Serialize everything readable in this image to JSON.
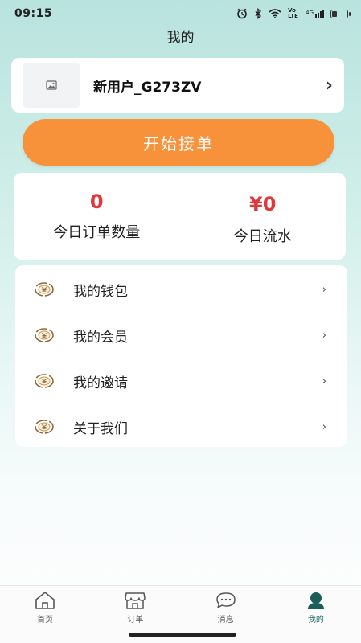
{
  "status_bar": {
    "time": "09:15",
    "signal_text": "4G",
    "volte_text": "Vo LTE"
  },
  "header": {
    "title": "我的"
  },
  "profile": {
    "username": "新用户_G273ZV",
    "avatar_icon": "image-icon",
    "chevron": "›"
  },
  "action": {
    "start_label": "开始接单",
    "color": "#f7913a"
  },
  "stats": {
    "orders_count": "0",
    "orders_label": "今日订单数量",
    "revenue_value": "¥0",
    "revenue_label": "今日流水",
    "value_color": "#e2373b"
  },
  "menu": {
    "items": [
      {
        "label": "我的钱包",
        "icon": "coin-icon",
        "chevron": "›"
      },
      {
        "label": "我的会员",
        "icon": "coin-icon",
        "chevron": "›"
      },
      {
        "label": "我的邀请",
        "icon": "coin-icon",
        "chevron": "›"
      },
      {
        "label": "关于我们",
        "icon": "coin-icon",
        "chevron": "›"
      }
    ]
  },
  "tabbar": {
    "tabs": [
      {
        "label": "首页",
        "icon": "home-icon"
      },
      {
        "label": "订单",
        "icon": "shop-icon"
      },
      {
        "label": "消息",
        "icon": "message-icon"
      },
      {
        "label": "我的",
        "icon": "profile-icon",
        "active": true
      }
    ],
    "active_color": "#1b6e67"
  }
}
